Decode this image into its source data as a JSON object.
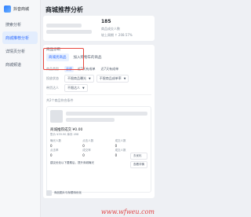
{
  "sidebar": {
    "brand": "抖音商城",
    "items": [
      {
        "label": "搜索分析",
        "active": false
      },
      {
        "label": "商城推荐分析",
        "active": true
      },
      {
        "label": "详情页分析",
        "active": false
      },
      {
        "label": "商城频道",
        "active": false
      }
    ]
  },
  "header": {
    "title": "商城推荐分析"
  },
  "stats": {
    "first_value": "185",
    "first_label": "商品成交人数",
    "second_label": "较上周期 ↑ 208.57%"
  },
  "products": {
    "section_label": "商品诊断",
    "tabs": [
      "商城优商品",
      "加入购物车的商品"
    ],
    "filters": [
      {
        "label": "商品类型",
        "chips": [
          "全部",
          "近7天有成单",
          "近7天有成单"
        ]
      },
      {
        "label": "投放状态",
        "selects": [
          "不限商品曝光",
          "不限商品成单率"
        ]
      },
      {
        "label": "带货达人",
        "selects": [
          "不限达人"
        ]
      }
    ],
    "total_text": "共2个商品符合条件",
    "item": {
      "price_label": "商城推荐成交 ¥0.00",
      "price_sub": "售价 ¥39.90  库存 498",
      "metrics": [
        {
          "label": "曝光人数",
          "value": "0"
        },
        {
          "label": "点击人数",
          "value": "0"
        },
        {
          "label": "成交人数",
          "value": "0"
        },
        {
          "label": "点击率",
          "value": "0"
        },
        {
          "label": "成交率",
          "value": "0"
        },
        {
          "label": "成交人数",
          "value": "0"
        }
      ],
      "note": "建议优化以下要素后，提升商城曝光",
      "buttons": [
        "去优化",
        "查看详情"
      ]
    },
    "bottom_text": "商品图片与标题待优化"
  },
  "watermark": "www.wfweu.com",
  "colors": {
    "accent": "#2c6bff",
    "highlight": "#e8483f"
  }
}
